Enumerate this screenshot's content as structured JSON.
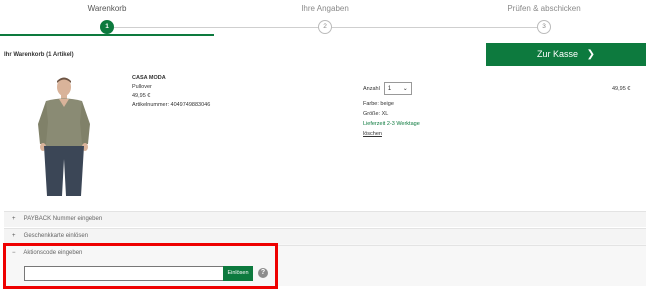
{
  "stepper": {
    "steps": [
      {
        "label": "Warenkorb",
        "number": "1"
      },
      {
        "label": "Ihre Angaben",
        "number": "2"
      },
      {
        "label": "Prüfen & abschicken",
        "number": "3"
      }
    ]
  },
  "cart": {
    "title": "Ihr Warenkorb (1 Artikel)",
    "checkout_label": "Zur Kasse"
  },
  "product": {
    "brand": "CASA MODA",
    "name": "Pullover",
    "price": "49,95 €",
    "article_number": "Artikelnummer: 4049749883046",
    "quantity_label": "Anzahl",
    "quantity_value": "1",
    "color": "Farbe: beige",
    "size": "Größe: XL",
    "delivery": "Lieferzeit 2-3 Werktage",
    "remove_label": "löschen",
    "line_total": "49,95 €",
    "image_colors": {
      "sweater": "#8a8b74",
      "skin": "#d9b39a",
      "pants": "#3b4656"
    }
  },
  "accordions": {
    "payback": {
      "sign": "+",
      "label": "PAYBACK Nummer eingeben"
    },
    "giftcard": {
      "sign": "+",
      "label": "Geschenkkarte einlösen"
    },
    "promo": {
      "sign": "−",
      "label": "Aktionscode eingeben"
    }
  },
  "promo_form": {
    "input_value": "",
    "redeem_label": "Einlösen",
    "help_symbol": "?"
  },
  "colors": {
    "accent": "#0d7a3e",
    "highlight": "#ee0000"
  }
}
